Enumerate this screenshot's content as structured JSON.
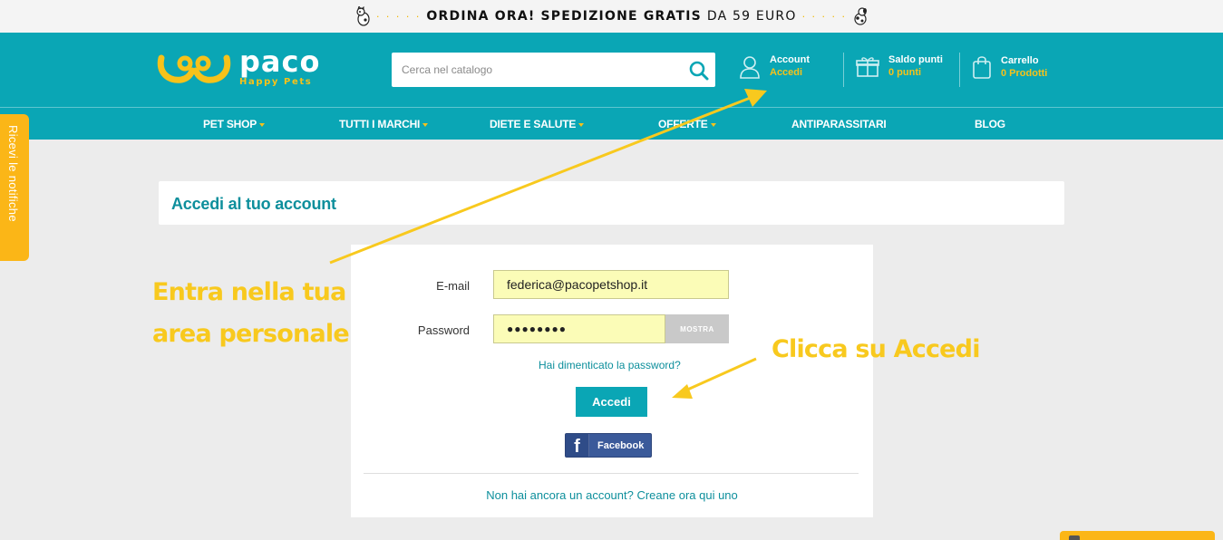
{
  "promo": {
    "lead": "ORDINA ORA!",
    "strong": "SPEDIZIONE GRATIS",
    "rest": "DA 59 EURO",
    "dots": "· · · · ·"
  },
  "brand": {
    "name": "paco",
    "tagline": "Happy Pets"
  },
  "search": {
    "placeholder": "Cerca nel catalogo"
  },
  "header": {
    "account": {
      "label": "Account",
      "value": "Accedi"
    },
    "points": {
      "label": "Saldo punti",
      "value": "0 punti"
    },
    "cart": {
      "label": "Carrello",
      "value": "0 Prodotti"
    }
  },
  "nav": [
    "PET SHOP",
    "TUTTI I MARCHI",
    "DIETE E SALUTE",
    "OFFERTE",
    "ANTIPARASSITARI",
    "BLOG"
  ],
  "notifications_tab": "Ricevi le notifiche",
  "page_title": "Accedi al tuo account",
  "login": {
    "email_label": "E-mail",
    "email_value": "federica@pacopetshop.it",
    "password_label": "Password",
    "password_value": "●●●●●●●●",
    "show_button": "MOSTRA",
    "forgot": "Hai dimenticato la password?",
    "submit": "Accedi",
    "facebook": "Facebook",
    "register": "Non hai ancora un account? Creane ora qui uno"
  },
  "annotations": {
    "left_line1": "Entra nella tua",
    "left_line2": "area personale",
    "right": "Clicca su Accedi"
  },
  "colors": {
    "brand_teal": "#0aa6b5",
    "accent_yellow": "#f6c21a",
    "annotation_yellow": "#f8c91e",
    "field_bg": "#fbfcb7"
  }
}
